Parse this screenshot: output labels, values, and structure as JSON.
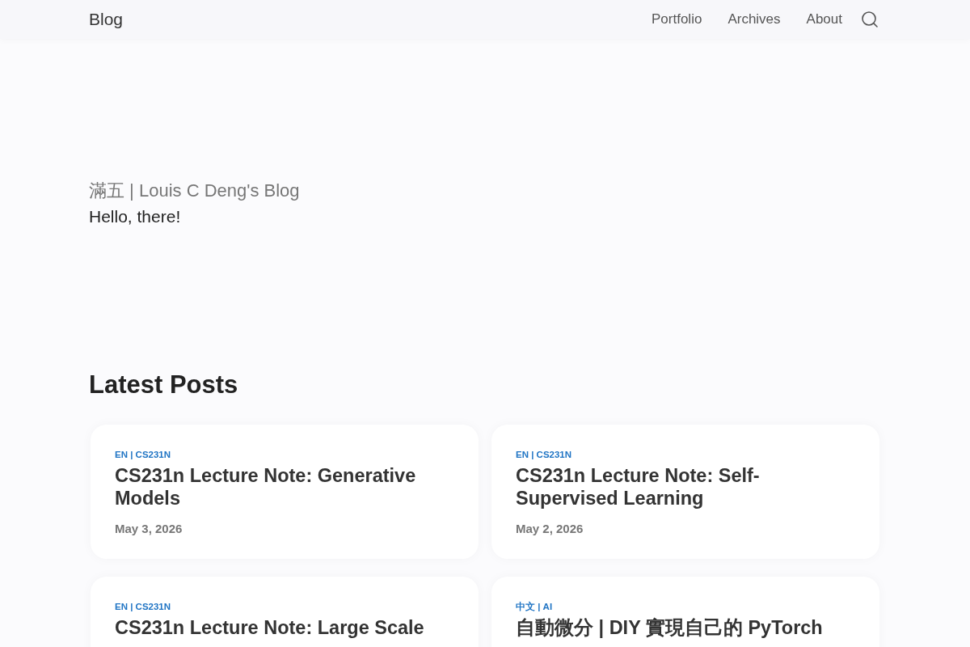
{
  "header": {
    "brand": "Blog",
    "nav": [
      {
        "label": "Portfolio"
      },
      {
        "label": "Archives"
      },
      {
        "label": "About"
      }
    ]
  },
  "hero": {
    "title": "滿五 | Louis C Deng's Blog",
    "subtitle": "Hello, there!"
  },
  "latest_posts": {
    "heading": "Latest Posts",
    "posts": [
      {
        "tag": "EN | CS231N",
        "title": "CS231n Lecture Note: Generative Models",
        "date": "May 3, 2026"
      },
      {
        "tag": "EN | CS231N",
        "title": "CS231n Lecture Note: Self-Supervised Learning",
        "date": "May 2, 2026"
      },
      {
        "tag": "EN | CS231N",
        "title": "CS231n Lecture Note: Large Scale"
      },
      {
        "tag": "中文 | AI",
        "title": "自動微分 | DIY 實現自己的 PyTorch"
      }
    ]
  }
}
